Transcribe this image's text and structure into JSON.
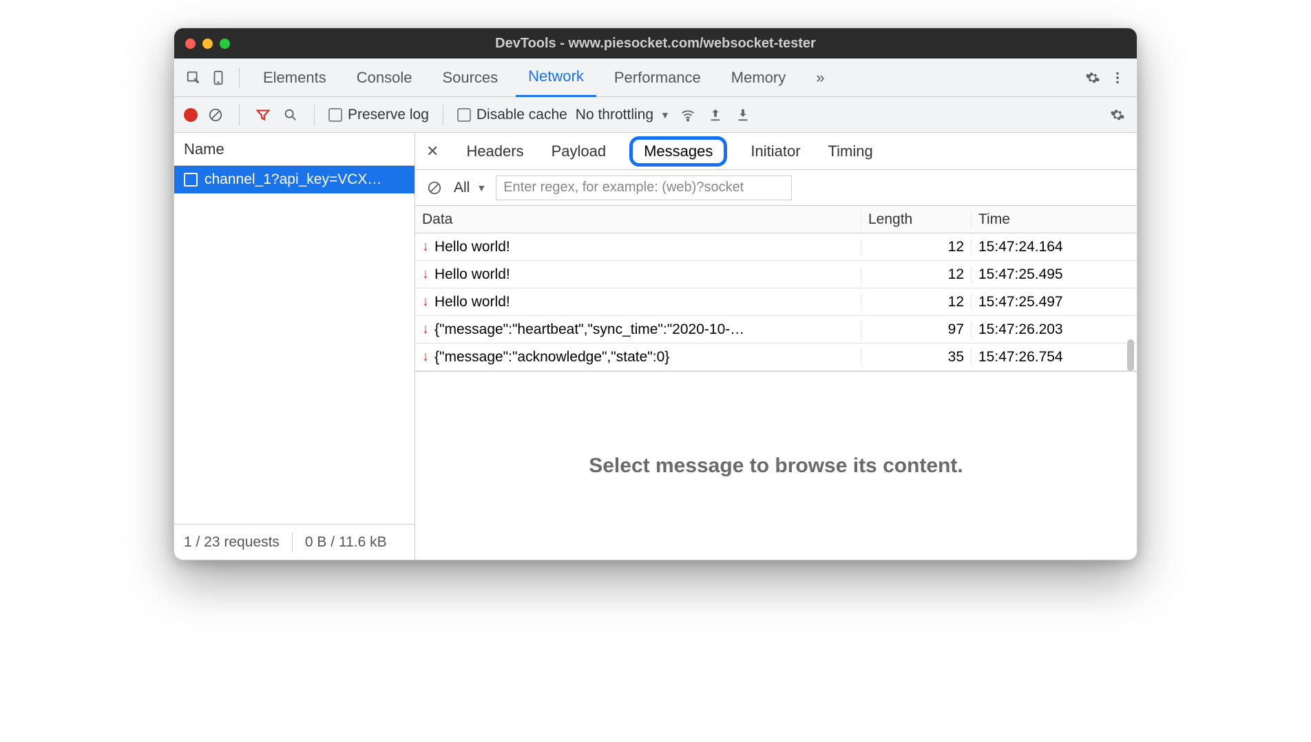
{
  "window": {
    "title": "DevTools - www.piesocket.com/websocket-tester"
  },
  "mainTabs": {
    "items": [
      "Elements",
      "Console",
      "Sources",
      "Network",
      "Performance",
      "Memory"
    ],
    "active": "Network",
    "more": "»"
  },
  "toolbar": {
    "preserve": "Preserve log",
    "disableCache": "Disable cache",
    "throttle": "No throttling"
  },
  "left": {
    "header": "Name",
    "requestName": "channel_1?api_key=VCX…",
    "footerRequests": "1 / 23 requests",
    "footerTransfer": "0 B / 11.6 kB"
  },
  "detailTabs": [
    "Headers",
    "Payload",
    "Messages",
    "Initiator",
    "Timing"
  ],
  "detailActive": "Messages",
  "filter": {
    "all": "All",
    "placeholder": "Enter regex, for example: (web)?socket"
  },
  "columns": {
    "data": "Data",
    "length": "Length",
    "time": "Time"
  },
  "messages": [
    {
      "data": "Hello world!",
      "length": "12",
      "time": "15:47:24.164"
    },
    {
      "data": "Hello world!",
      "length": "12",
      "time": "15:47:25.495"
    },
    {
      "data": "Hello world!",
      "length": "12",
      "time": "15:47:25.497"
    },
    {
      "data": "{\"message\":\"heartbeat\",\"sync_time\":\"2020-10-…",
      "length": "97",
      "time": "15:47:26.203"
    },
    {
      "data": "{\"message\":\"acknowledge\",\"state\":0}",
      "length": "35",
      "time": "15:47:26.754"
    }
  ],
  "bottomMessage": "Select message to browse its content."
}
